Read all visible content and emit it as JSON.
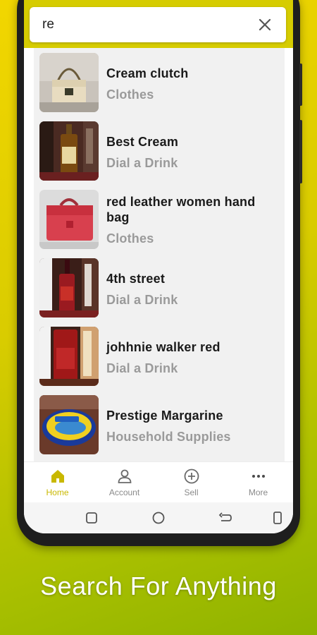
{
  "search": {
    "query": "re",
    "clear_icon": "close-icon"
  },
  "results": [
    {
      "title": "Cream clutch",
      "category": "Clothes",
      "image": "cream-handbag-photo"
    },
    {
      "title": "Best Cream",
      "category": "Dial a Drink",
      "image": "liquor-bottle-photo"
    },
    {
      "title": "red leather women hand bag",
      "category": "Clothes",
      "image": "red-handbag-photo"
    },
    {
      "title": "4th street",
      "category": "Dial a Drink",
      "image": "wine-bottle-photo"
    },
    {
      "title": "johhnie walker red",
      "category": "Dial a Drink",
      "image": "whisky-bottle-photo"
    },
    {
      "title": "Prestige Margarine",
      "category": "Household Supplies",
      "image": "margarine-tub-photo"
    }
  ],
  "bottom_nav": {
    "items": [
      {
        "label": "Home",
        "icon": "home-icon",
        "active": true
      },
      {
        "label": "Account",
        "icon": "account-icon",
        "active": false
      },
      {
        "label": "Sell",
        "icon": "plus-circle-icon",
        "active": false
      },
      {
        "label": "More",
        "icon": "more-dots-icon",
        "active": false
      }
    ]
  },
  "colors": {
    "accent": "#d6cc00",
    "active_nav": "#c9b800",
    "category_text": "#9a9a9a"
  },
  "caption": "Search For Anything"
}
